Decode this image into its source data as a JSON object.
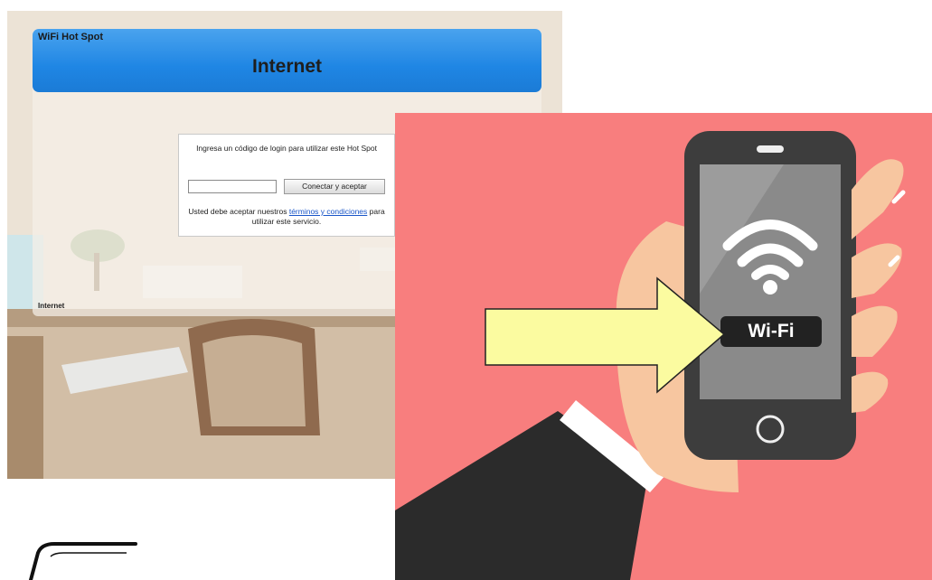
{
  "hotspot_portal": {
    "brand": "WiFi Hot Spot",
    "title": "Internet",
    "login_prompt": "Ingresa un código de login para utilizar este Hot Spot",
    "code_input": {
      "value": "",
      "placeholder": ""
    },
    "connect_button_label": "Conectar y aceptar",
    "terms": {
      "prefix": "Usted debe aceptar nuestros ",
      "link_text": "términos y condiciones",
      "suffix": " para utilizar este servicio."
    },
    "footer_label": "Internet",
    "header_color": "#1f86e4",
    "link_color": "#1a56c8"
  },
  "illustration": {
    "badge_text": "Wi-Fi",
    "background_color": "#f87e7e",
    "phone_color": "#3d3d3d",
    "screen_color": "#8a8a8a",
    "hand_color": "#f7c6a0",
    "arrow_color": "#fbfba0",
    "icons": [
      "wifi-icon",
      "home-button-icon",
      "speaker-icon"
    ]
  }
}
